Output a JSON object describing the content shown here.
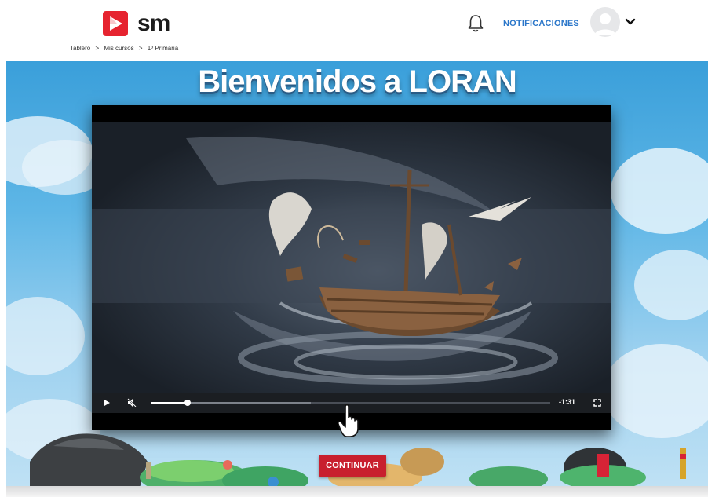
{
  "header": {
    "brand": "sm",
    "notifications_label": "NOTIFICACIONES",
    "icons": {
      "bell": "bell-icon",
      "avatar": "user-avatar",
      "caret": "chevron-down-icon"
    }
  },
  "breadcrumb": [
    "Tablero",
    ">",
    "Mis cursos",
    ">",
    "1º Primaria"
  ],
  "welcome": {
    "title": "Bienvenidos a LORAN"
  },
  "video": {
    "progress": 0.09,
    "buffered": 0.4,
    "time_remaining": "-1:31",
    "icons": {
      "play": "play-icon",
      "mute": "mute-icon",
      "fullscreen": "fullscreen-icon"
    }
  },
  "actions": {
    "continue_label": "CONTINUAR"
  },
  "colors": {
    "brand_red": "#e6232f",
    "continue_red": "#c81f2e",
    "link_blue": "#2a76c9",
    "sky": "#5eb6e6"
  }
}
